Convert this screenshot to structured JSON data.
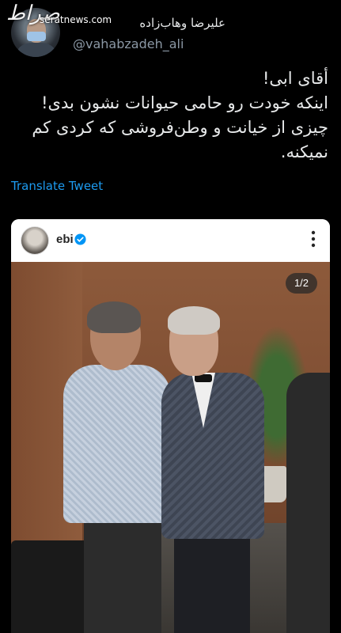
{
  "watermark": {
    "logo_text": "صراط",
    "site_url": "seratnews.com"
  },
  "tweet": {
    "display_name": "علیرضا وهاب‌زاده",
    "handle": "@vahabzadeh_ali",
    "lines": [
      "أقای ابی!",
      "اینکه خودت رو حامی حیوانات نشون بدی!",
      "چیزی از خیانت و وطن‌فروشی که کردی کم",
      "نمیکنه."
    ],
    "translate_label": "Translate Tweet"
  },
  "embedded_post": {
    "username": "ebi",
    "verified": true,
    "carousel_counter": "1/2",
    "icons": [
      "verified-badge-icon",
      "more-options-icon"
    ],
    "accent_color": "#0095f6"
  },
  "colors": {
    "background": "#000000",
    "text": "#e7e9ea",
    "muted": "#8b98a5",
    "link": "#1d9bf0"
  }
}
